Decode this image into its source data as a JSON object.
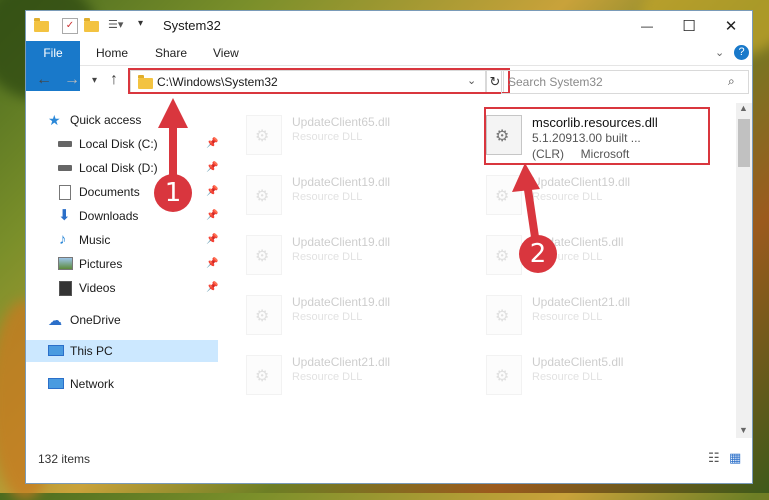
{
  "window": {
    "title": "System32",
    "controls": {
      "minimize": "—",
      "maximize": "☐",
      "close": "✕"
    }
  },
  "ribbon": {
    "tabs": [
      "File",
      "Home",
      "Share",
      "View"
    ]
  },
  "nav": {
    "address": "C:\\Windows\\System32",
    "search_placeholder": "Search System32"
  },
  "sidebar": {
    "items": [
      {
        "label": "Quick access",
        "icon": "star-icon"
      },
      {
        "label": "Local Disk (C:)",
        "icon": "drive-icon"
      },
      {
        "label": "Local Disk (D:)",
        "icon": "drive-icon"
      },
      {
        "label": "Documents",
        "icon": "documents-icon"
      },
      {
        "label": "Downloads",
        "icon": "download-arrow-icon"
      },
      {
        "label": "Music",
        "icon": "music-note-icon"
      },
      {
        "label": "Pictures",
        "icon": "pictures-icon"
      },
      {
        "label": "Videos",
        "icon": "videos-icon"
      },
      {
        "label": "OneDrive",
        "icon": "cloud-icon"
      },
      {
        "label": "This PC",
        "icon": "computer-icon"
      },
      {
        "label": "Network",
        "icon": "network-icon"
      }
    ]
  },
  "files": [
    {
      "name": "UpdateClient65.dll",
      "type": "Resource DLL"
    },
    {
      "name": "mscorlib.resources.dll",
      "type": "5.1.20913.00 built ...",
      "type2": "(CLR)     Microsoft"
    },
    {
      "name": "UpdateClient19.dll",
      "type": "Resource DLL"
    },
    {
      "name": "UpdateClient19.dll",
      "type": "Resource DLL"
    },
    {
      "name": "UpdateClient19.dll",
      "type": "Resource DLL"
    },
    {
      "name": "UpdateClient5.dll",
      "type": "Resource DLL"
    },
    {
      "name": "UpdateClient19.dll",
      "type": "Resource DLL"
    },
    {
      "name": "UpdateClient21.dll",
      "type": "Resource DLL"
    },
    {
      "name": "UpdateClient21.dll",
      "type": "Resource DLL"
    },
    {
      "name": "UpdateClient5.dll",
      "type": "Resource DLL"
    }
  ],
  "status": {
    "item_count": "132 items"
  },
  "annotations": {
    "step1": "1",
    "step2": "2",
    "color": "#d9363e"
  }
}
